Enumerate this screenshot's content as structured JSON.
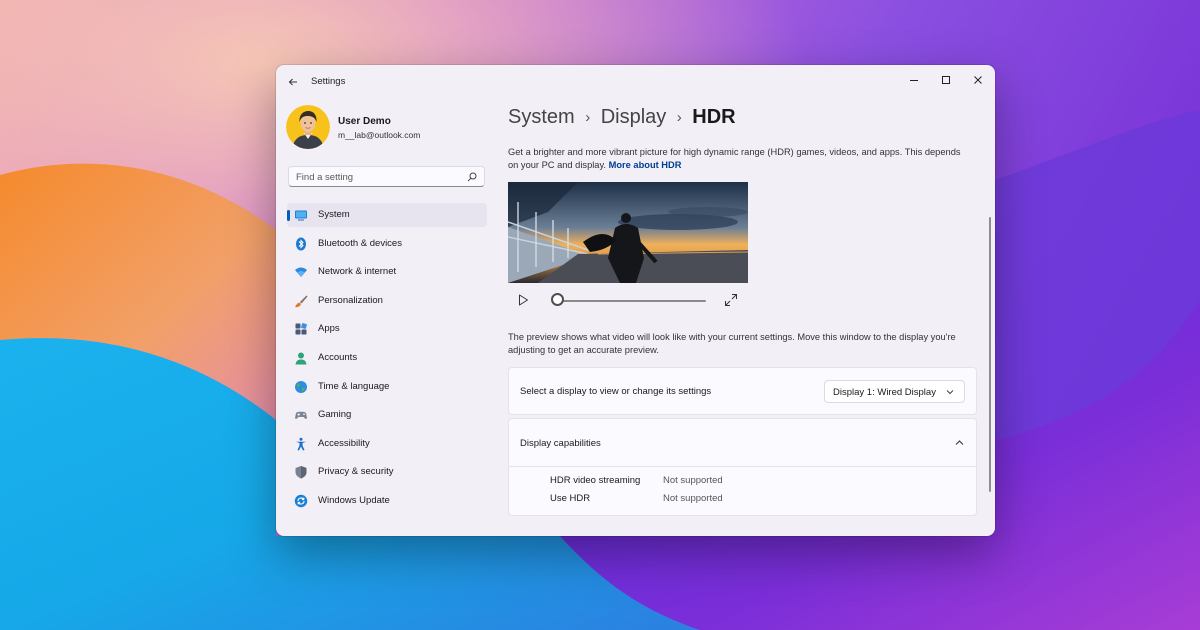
{
  "window": {
    "app_title": "Settings",
    "controls": {
      "minimize": "minimize-icon",
      "maximize": "maximize-icon",
      "close": "close-icon"
    }
  },
  "user": {
    "name": "User Demo",
    "email": "m__lab@outlook.com"
  },
  "search": {
    "placeholder": "Find a setting"
  },
  "nav": [
    {
      "label": "System",
      "icon": "system-icon",
      "active": true
    },
    {
      "label": "Bluetooth & devices",
      "icon": "bluetooth-icon"
    },
    {
      "label": "Network & internet",
      "icon": "wifi-icon"
    },
    {
      "label": "Personalization",
      "icon": "brush-icon"
    },
    {
      "label": "Apps",
      "icon": "apps-icon"
    },
    {
      "label": "Accounts",
      "icon": "accounts-icon"
    },
    {
      "label": "Time & language",
      "icon": "globe-icon"
    },
    {
      "label": "Gaming",
      "icon": "gamepad-icon"
    },
    {
      "label": "Accessibility",
      "icon": "accessibility-icon"
    },
    {
      "label": "Privacy & security",
      "icon": "shield-icon"
    },
    {
      "label": "Windows Update",
      "icon": "update-icon"
    }
  ],
  "breadcrumb": [
    "System",
    "Display",
    "HDR"
  ],
  "description": {
    "text": "Get a brighter and more vibrant picture for high dynamic range (HDR) games, videos, and apps. This depends on your PC and display.",
    "link": "More about HDR"
  },
  "video": {
    "progress": 0
  },
  "preview_note": "The preview shows what video will look like with your current settings. Move this window to the display you're adjusting to get an accurate preview.",
  "display_select": {
    "label": "Select a display to view or change its settings",
    "value": "Display 1: Wired Display"
  },
  "capabilities": {
    "title": "Display capabilities",
    "expanded": true,
    "rows": [
      {
        "name": "HDR video streaming",
        "value": "Not supported"
      },
      {
        "name": "Use HDR",
        "value": "Not supported"
      }
    ]
  },
  "colors": {
    "accent": "#005fb8",
    "link": "#003e92",
    "window_bg": "#f2eff7"
  }
}
